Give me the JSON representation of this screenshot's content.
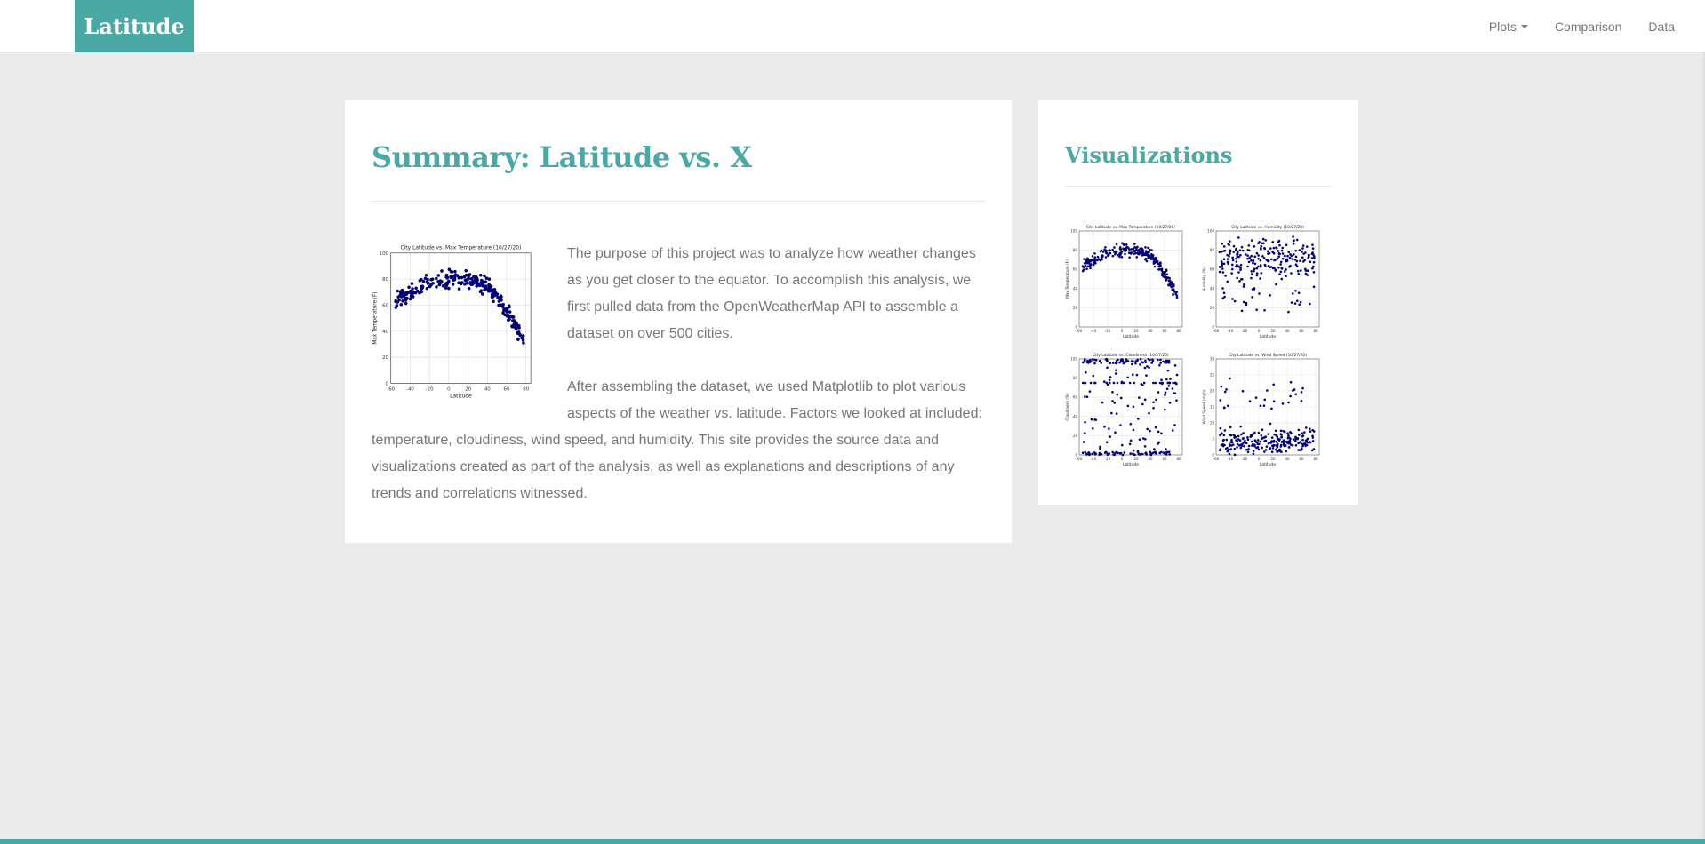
{
  "brand": "Latitude",
  "nav": {
    "plots": "Plots",
    "comparison": "Comparison",
    "data": "Data"
  },
  "summary": {
    "heading": "Summary: Latitude vs. X",
    "paragraph1": "The purpose of this project was to analyze how weather changes as you get closer to the equator. To accomplish this analysis, we first pulled data from the OpenWeatherMap API to assemble a dataset on over 500 cities.",
    "paragraph2": "After assembling the dataset, we used Matplotlib to plot various aspects of the weather vs. latitude. Factors we looked at included: temperature, cloudiness, wind speed, and humidity. This site provides the source data and visualizations created as part of the analysis, as well as explanations and descriptions of any trends and correlations witnessed."
  },
  "visualizations": {
    "heading": "Visualizations"
  },
  "plots": [
    {
      "title": "City Latitude vs. Max Temperature (10/27/20)",
      "xlabel": "Latitude",
      "ylabel": "Max Temperature (F)",
      "kind": "temp",
      "xticks": [
        "-60",
        "-40",
        "-20",
        "0",
        "20",
        "40",
        "60",
        "80"
      ],
      "yticks": [
        "0",
        "20",
        "40",
        "60",
        "80",
        "100"
      ]
    },
    {
      "title": "City Latitude vs. Humidity (10/27/20)",
      "xlabel": "Latitude",
      "ylabel": "Humidity (%)",
      "kind": "humidity",
      "xticks": [
        "-60",
        "-40",
        "-20",
        "0",
        "20",
        "40",
        "60",
        "80"
      ],
      "yticks": [
        "0",
        "20",
        "40",
        "60",
        "80",
        "100"
      ]
    },
    {
      "title": "City Latitude vs. Cloudiness (10/27/20)",
      "xlabel": "Latitude",
      "ylabel": "Cloudiness (%)",
      "kind": "cloud",
      "xticks": [
        "-60",
        "-40",
        "-20",
        "0",
        "20",
        "40",
        "60",
        "80"
      ],
      "yticks": [
        "0",
        "20",
        "40",
        "60",
        "80",
        "100"
      ]
    },
    {
      "title": "City Latitude vs. Wind Speed (10/27/20)",
      "xlabel": "Latitude",
      "ylabel": "Wind Speed (mph)",
      "kind": "wind",
      "xticks": [
        "-60",
        "-40",
        "-20",
        "0",
        "20",
        "40",
        "60",
        "80"
      ],
      "yticks": [
        "0",
        "5",
        "10",
        "15",
        "20",
        "25",
        "30"
      ]
    }
  ],
  "colors": {
    "accent": "#4aa8a5",
    "point": "#00008b",
    "background": "#ebebeb"
  }
}
